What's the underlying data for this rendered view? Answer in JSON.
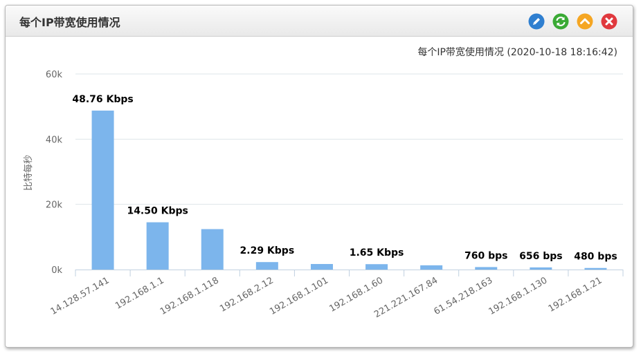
{
  "header": {
    "title": "每个IP带宽使用情况",
    "buttons": [
      {
        "name": "edit-button",
        "icon": "pencil-icon",
        "color": "#2f7fd0"
      },
      {
        "name": "refresh-button",
        "icon": "refresh-icon",
        "color": "#3aaa35"
      },
      {
        "name": "collapse-button",
        "icon": "chevron-up-icon",
        "color": "#f5a623"
      },
      {
        "name": "close-button",
        "icon": "close-icon",
        "color": "#e0393e"
      }
    ]
  },
  "chart_data": {
    "type": "bar",
    "title": "每个IP带宽使用情况 (2020-10-18 18:16:42)",
    "ylabel": "比特每秒",
    "xlabel": "",
    "ylim": [
      0,
      60000
    ],
    "yticks": [
      0,
      20000,
      40000,
      60000
    ],
    "ytick_labels": [
      "0k",
      "20k",
      "40k",
      "60k"
    ],
    "grid": true,
    "bar_color": "#7cb5ec",
    "categories": [
      "14.128.57.141",
      "192.168.1.1",
      "192.168.1.118",
      "192.168.2.12",
      "192.168.1.101",
      "192.168.1.60",
      "221.221.167.84",
      "61.54.218.163",
      "192.168.1.130",
      "192.168.1.21"
    ],
    "values": [
      48760,
      14500,
      12400,
      2290,
      1700,
      1650,
      1300,
      760,
      656,
      480
    ],
    "data_labels": [
      "48.76 Kbps",
      "14.50 Kbps",
      "",
      "2.29 Kbps",
      "",
      "1.65 Kbps",
      "",
      "760 bps",
      "656 bps",
      "480 bps"
    ]
  }
}
